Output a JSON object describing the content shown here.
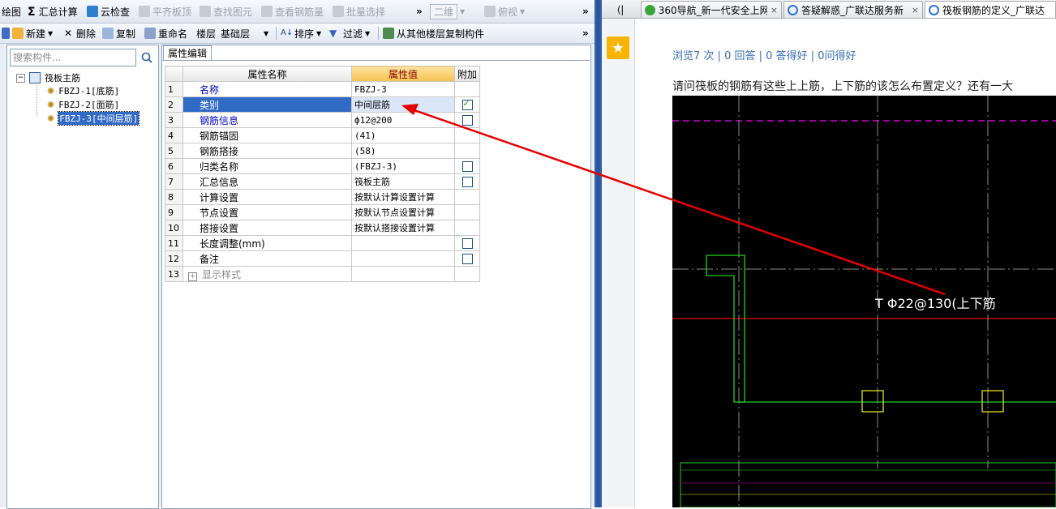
{
  "app": {
    "toolbar1": {
      "draw": "绘图",
      "summary_calc": "汇总计算",
      "cloud_check": "云检查",
      "flush_slab_top": "平齐板顶",
      "find_element": "查找图元",
      "view_rebar": "查看钢筋量",
      "batch_select": "批量选择",
      "more": "»",
      "view_mode": "二维",
      "view_angle": "俯视"
    },
    "toolbar2": {
      "new": "新建",
      "delete": "删除",
      "copy": "复制",
      "rename": "重命名",
      "floor_label": "楼层",
      "floor_value": "基础层",
      "sort": "排序",
      "filter": "过滤",
      "copy_from_floor": "从其他楼层复制构件",
      "more": "»"
    },
    "search": {
      "placeholder": "搜索构件..."
    },
    "tree": {
      "root": "筏板主筋",
      "children": [
        "FBZJ-1[底筋]",
        "FBZJ-2[面筋]",
        "FBZJ-3[中间层筋]"
      ],
      "selected_index": 2
    },
    "property_tab": "属性编辑",
    "table": {
      "headers": [
        "属性名称",
        "属性值",
        "附加"
      ],
      "rows": [
        {
          "num": "1",
          "name": "名称",
          "value": "FBZJ-3",
          "blue": true,
          "checkbox": "none"
        },
        {
          "num": "2",
          "name": "类别",
          "value": "中间层筋",
          "blue": true,
          "checkbox": "checked"
        },
        {
          "num": "3",
          "name": "钢筋信息",
          "value": "ф12@200",
          "blue": true,
          "checkbox": "unchecked"
        },
        {
          "num": "4",
          "name": "钢筋锚固",
          "value": "(41)",
          "blue": false,
          "checkbox": "none"
        },
        {
          "num": "5",
          "name": "钢筋搭接",
          "value": "(58)",
          "blue": false,
          "checkbox": "none"
        },
        {
          "num": "6",
          "name": "归类名称",
          "value": "(FBZJ-3)",
          "blue": false,
          "checkbox": "unchecked"
        },
        {
          "num": "7",
          "name": "汇总信息",
          "value": "筏板主筋",
          "blue": false,
          "checkbox": "unchecked"
        },
        {
          "num": "8",
          "name": "计算设置",
          "value": "按默认计算设置计算",
          "blue": false,
          "checkbox": "none"
        },
        {
          "num": "9",
          "name": "节点设置",
          "value": "按默认节点设置计算",
          "blue": false,
          "checkbox": "none"
        },
        {
          "num": "10",
          "name": "搭接设置",
          "value": "按默认搭接设置计算",
          "blue": false,
          "checkbox": "none"
        },
        {
          "num": "11",
          "name": "长度调整(mm)",
          "value": "",
          "blue": false,
          "checkbox": "unchecked"
        },
        {
          "num": "12",
          "name": "备注",
          "value": "",
          "blue": false,
          "checkbox": "unchecked"
        },
        {
          "num": "13",
          "name": "显示样式",
          "value": "",
          "blue": false,
          "checkbox": "none",
          "expandable": true
        }
      ]
    }
  },
  "browser": {
    "back": "⟨|",
    "tabs": [
      {
        "title": "360导航_新一代安全上网",
        "close": "×"
      },
      {
        "title": "答疑解惑_广联达服务新",
        "close": "×"
      },
      {
        "title": "筏板钢筋的定义_广联达",
        "close": ""
      }
    ],
    "stats": {
      "views": "浏览7 次",
      "answers": "0 回答",
      "good_answers": "0 答得好",
      "asks": "0问得好",
      "sep": "|"
    },
    "question": "请问筏板的钢筋有这些上上筋，上下筋的该怎么布置定义？还有一大",
    "cad_label": "T Φ22@130(上下筋"
  },
  "colors": {
    "accent_blue": "#316ac5",
    "arrow_red": "#e60000",
    "link_blue": "#3b6fb6",
    "header_orange": "#f6c14f"
  }
}
